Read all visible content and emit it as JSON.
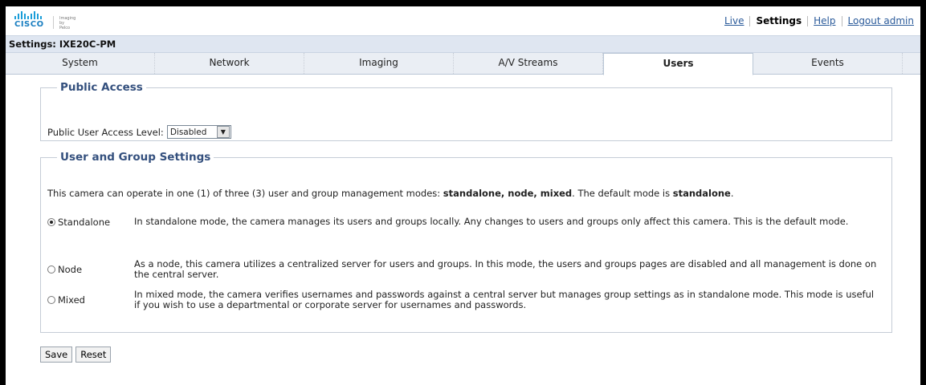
{
  "header": {
    "brand_cisco": "CISCO",
    "brand_imaging": "Imaging by Pelco",
    "links": [
      {
        "label": "Live"
      },
      {
        "label": "Settings"
      },
      {
        "label": "Help"
      },
      {
        "label": "Logout admin"
      }
    ]
  },
  "title": "Settings: IXE20C-PM",
  "tabs": [
    {
      "label": "System"
    },
    {
      "label": "Network"
    },
    {
      "label": "Imaging"
    },
    {
      "label": "A/V Streams"
    },
    {
      "label": "Users"
    },
    {
      "label": "Events"
    }
  ],
  "public_access": {
    "legend": "Public Access",
    "field_label": "Public User Access Level:",
    "selected": "Disabled"
  },
  "user_group": {
    "legend": "User and Group Settings",
    "intro_pre": "This camera can operate in one (1) of three (3) user and group management modes: ",
    "intro_modes": "standalone, node, mixed",
    "intro_mid": ". The default mode is ",
    "intro_default": "standalone",
    "intro_end": ".",
    "options": [
      {
        "label": "Standalone",
        "checked": true,
        "desc": "In standalone mode, the camera manages its users and groups locally. Any changes to users and groups only affect this camera. This is the default mode."
      },
      {
        "label": "Node",
        "checked": false,
        "desc": "As a node, this camera utilizes a centralized server for users and groups. In this mode, the users and groups pages are disabled and all management is done on the central server."
      },
      {
        "label": "Mixed",
        "checked": false,
        "desc": "In mixed mode, the camera verifies usernames and passwords against a central server but manages group settings as in standalone mode. This mode is useful if you wish to use a departmental or corporate server for usernames and passwords."
      }
    ]
  },
  "buttons": {
    "save": "Save",
    "reset": "Reset"
  },
  "colors": {
    "accent": "#334f7d",
    "link": "#2a5a9a",
    "brand": "#1b9ed9"
  }
}
